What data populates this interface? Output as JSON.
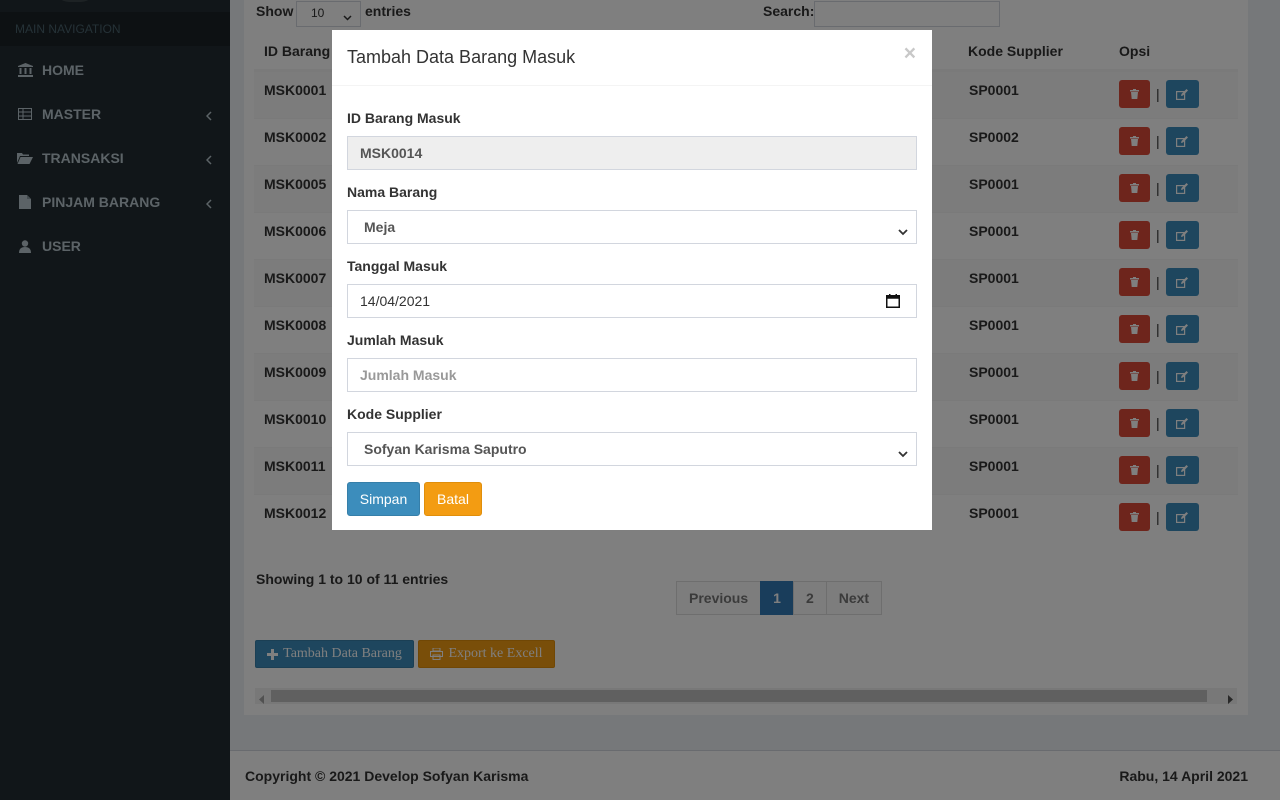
{
  "sidebar": {
    "header": "MAIN NAVIGATION",
    "items": [
      {
        "label": "HOME"
      },
      {
        "label": "MASTER"
      },
      {
        "label": "TRANSAKSI"
      },
      {
        "label": "PINJAM BARANG"
      },
      {
        "label": "USER"
      }
    ]
  },
  "table_controls": {
    "show_label": "Show",
    "page_length": "10",
    "entries_label": "entries",
    "search_label": "Search:"
  },
  "table": {
    "headers": {
      "id": "ID Barang",
      "supplier": "Kode Supplier",
      "opsi": "Opsi"
    },
    "rows": [
      {
        "id": "MSK0001",
        "supplier": "SP0001"
      },
      {
        "id": "MSK0002",
        "supplier": "SP0002"
      },
      {
        "id": "MSK0005",
        "supplier": "SP0001"
      },
      {
        "id": "MSK0006",
        "supplier": "SP0001"
      },
      {
        "id": "MSK0007",
        "supplier": "SP0001"
      },
      {
        "id": "MSK0008",
        "supplier": "SP0001"
      },
      {
        "id": "MSK0009",
        "supplier": "SP0001"
      },
      {
        "id": "MSK0010",
        "supplier": "SP0001"
      },
      {
        "id": "MSK0011",
        "supplier": "SP0001"
      },
      {
        "id": "MSK0012",
        "supplier": "SP0001"
      }
    ],
    "separator": "|",
    "info": "Showing 1 to 10 of 11 entries",
    "pagination": {
      "previous": "Previous",
      "page1": "1",
      "page2": "2",
      "next": "Next"
    }
  },
  "actions": {
    "add_label": "Tambah Data Barang",
    "export_label": "Export ke Excell"
  },
  "footer": {
    "copyright": "Copyright © 2021 Develop Sofyan Karisma",
    "date": "Rabu, 14 April 2021"
  },
  "modal": {
    "title": "Tambah Data Barang Masuk",
    "close": "×",
    "id_label": "ID Barang Masuk",
    "id_value": "MSK0014",
    "nama_label": "Nama Barang",
    "nama_value": "Meja",
    "tanggal_label": "Tanggal Masuk",
    "tanggal_value": "14/04/2021",
    "jumlah_label": "Jumlah Masuk",
    "jumlah_placeholder": "Jumlah Masuk",
    "supplier_label": "Kode Supplier",
    "supplier_value": "Sofyan Karisma Saputro",
    "simpan_label": "Simpan",
    "batal_label": "Batal"
  },
  "colors": {
    "sidebar_bg": "#222d32",
    "primary": "#3c8dbc",
    "danger": "#dd4b39",
    "warning": "#f39c12"
  }
}
